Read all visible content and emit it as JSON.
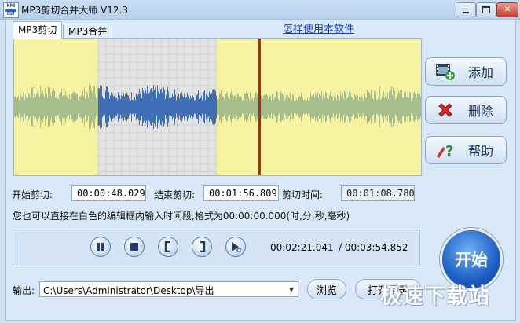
{
  "window": {
    "title": "MP3剪切合并大师 V12.3",
    "icon_text_top": "MP3",
    "icon_text_bottom": "CUT"
  },
  "tabs": [
    {
      "label": "MP3剪切",
      "selected": true
    },
    {
      "label": "MP3合并",
      "selected": false
    }
  ],
  "help_link": "怎样使用本软件",
  "side_buttons": {
    "add": {
      "label": "添加",
      "icon": "film-add-icon"
    },
    "delete": {
      "label": "删除",
      "icon": "red-x-icon"
    },
    "help": {
      "label": "帮助",
      "icon": "help-question-icon"
    }
  },
  "times": {
    "start_label": "开始剪切:",
    "start_value": "00:00:48.029",
    "end_label": "结束剪切:",
    "end_value": "00:01:56.809",
    "duration_label": "剪切时间:",
    "duration_value": "00:01:08.780"
  },
  "hint": "您也可以直接在白色的编辑框内输入时间段,格式为00:00:00.000(时,分,秒,毫秒)",
  "player": {
    "current_time": "00:02:21.041",
    "total_time": "/ 00:03:54.852",
    "buttons": [
      "pause-icon",
      "stop-icon",
      "mark-start-icon",
      "mark-end-icon",
      "play-selection-icon"
    ]
  },
  "start_button": "开始",
  "output": {
    "label": "输出:",
    "path": "C:\\Users\\Administrator\\Desktop\\导出",
    "browse_label": "浏览",
    "open_dir_label": "打开目录"
  },
  "watermark": "极速下载站",
  "colors": {
    "wave_background": "#f5f2a2",
    "selection_background": "#e3e3e3",
    "wave_green": "#a6bd8e",
    "wave_blue": "#3f6fb7",
    "playhead": "#b02a1a",
    "start_button": "#1d5fc5"
  }
}
